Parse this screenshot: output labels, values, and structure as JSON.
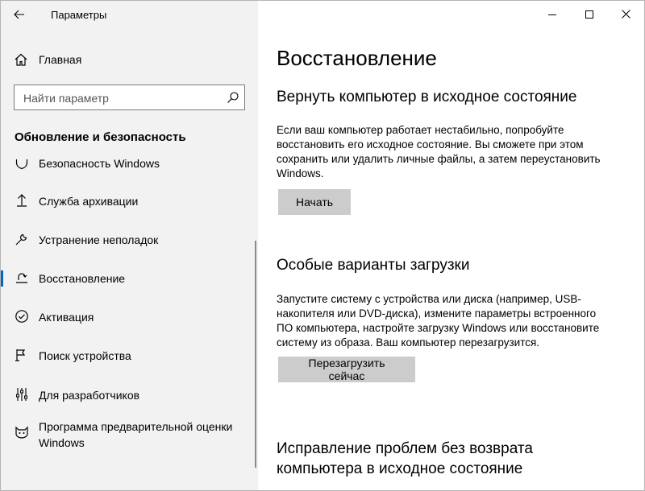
{
  "window": {
    "title": "Параметры"
  },
  "sidebar": {
    "home_label": "Главная",
    "search_placeholder": "Найти параметр",
    "section_title": "Обновление и безопасность",
    "items": [
      {
        "label": "Безопасность Windows",
        "icon": "shield-icon"
      },
      {
        "label": "Служба архивации",
        "icon": "backup-arrow-icon"
      },
      {
        "label": "Устранение неполадок",
        "icon": "wrench-icon"
      },
      {
        "label": "Восстановление",
        "icon": "recovery-icon",
        "active": true
      },
      {
        "label": "Активация",
        "icon": "check-circle-icon"
      },
      {
        "label": "Поиск устройства",
        "icon": "find-device-icon"
      },
      {
        "label": "Для разработчиков",
        "icon": "developer-sliders-icon"
      },
      {
        "label": "Программа предварительной оценки Windows",
        "icon": "insider-cat-icon"
      }
    ]
  },
  "main": {
    "title": "Восстановление",
    "reset": {
      "heading": "Вернуть компьютер в исходное состояние",
      "text": "Если ваш компьютер работает нестабильно, попробуйте восстановить его исходное состояние. Вы сможете при этом сохранить или удалить личные файлы, а затем переустановить Windows.",
      "button": "Начать"
    },
    "advanced": {
      "heading": "Особые варианты загрузки",
      "text": "Запустите систему с устройства или диска (например, USB-накопителя или DVD-диска), измените параметры встроенного ПО компьютера, настройте загрузку Windows или восстановите систему из образа. Ваш компьютер перезагрузится.",
      "button": "Перезагрузить сейчас"
    },
    "fix": {
      "heading": "Исправление проблем без возврата компьютера в исходное состояние"
    }
  },
  "colors": {
    "accent": "#0067c0",
    "sidebar_bg": "#f2f2f2",
    "button_bg": "#cccccc"
  }
}
